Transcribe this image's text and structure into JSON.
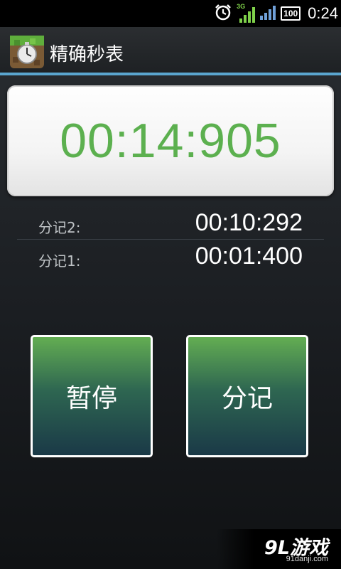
{
  "status_bar": {
    "network": "3G",
    "battery": "100",
    "time": "0:24"
  },
  "app": {
    "title": "精确秒表",
    "icon": "stopwatch-icon"
  },
  "stopwatch": {
    "current_time": "00:14:905"
  },
  "laps": [
    {
      "label": "分记2:",
      "time": "00:10:292"
    },
    {
      "label": "分记1:",
      "time": "00:01:400"
    }
  ],
  "buttons": {
    "pause": "暂停",
    "lap": "分记"
  },
  "watermark": {
    "logo": "9L游戏",
    "url": "91danji.com"
  },
  "colors": {
    "accent": "#5aa6cf",
    "time_green": "#5cb04f"
  }
}
